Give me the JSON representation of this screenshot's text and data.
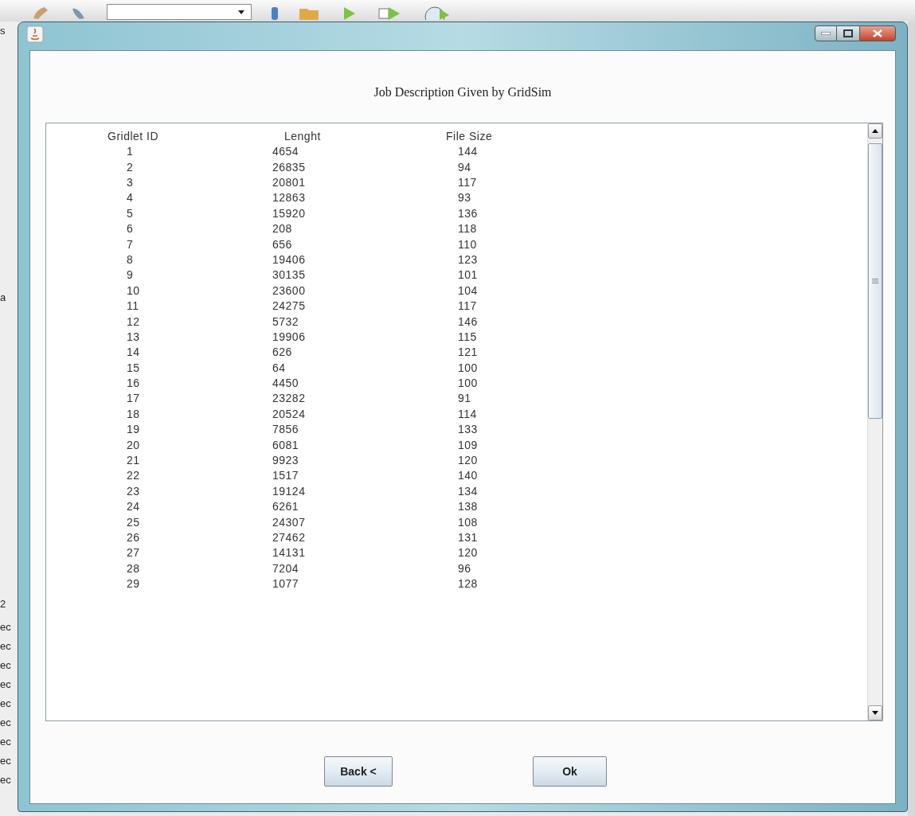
{
  "background": {
    "left_fragments": [
      "s",
      "a",
      "2",
      "ec",
      "ec",
      "ec",
      "ec",
      "ec",
      "ec",
      "ec",
      "ec",
      "ec"
    ]
  },
  "dialog": {
    "heading": "Job Description Given by GridSim",
    "table": {
      "columns": [
        "Gridlet ID",
        "Lenght",
        "File Size"
      ],
      "rows": [
        [
          "1",
          "4654",
          "144"
        ],
        [
          "2",
          "26835",
          "94"
        ],
        [
          "3",
          "20801",
          "117"
        ],
        [
          "4",
          "12863",
          "93"
        ],
        [
          "5",
          "15920",
          "136"
        ],
        [
          "6",
          "208",
          "118"
        ],
        [
          "7",
          "656",
          "110"
        ],
        [
          "8",
          "19406",
          "123"
        ],
        [
          "9",
          "30135",
          "101"
        ],
        [
          "10",
          "23600",
          "104"
        ],
        [
          "11",
          "24275",
          "117"
        ],
        [
          "12",
          "5732",
          "146"
        ],
        [
          "13",
          "19906",
          "115"
        ],
        [
          "14",
          "626",
          "121"
        ],
        [
          "15",
          "64",
          "100"
        ],
        [
          "16",
          "4450",
          "100"
        ],
        [
          "17",
          "23282",
          "91"
        ],
        [
          "18",
          "20524",
          "114"
        ],
        [
          "19",
          "7856",
          "133"
        ],
        [
          "20",
          "6081",
          "109"
        ],
        [
          "21",
          "9923",
          "120"
        ],
        [
          "22",
          "1517",
          "140"
        ],
        [
          "23",
          "19124",
          "134"
        ],
        [
          "24",
          "6261",
          "138"
        ],
        [
          "25",
          "24307",
          "108"
        ],
        [
          "26",
          "27462",
          "131"
        ],
        [
          "27",
          "14131",
          "120"
        ],
        [
          "28",
          "7204",
          "96"
        ],
        [
          "29",
          "1077",
          "128"
        ]
      ]
    },
    "buttons": [
      "Back <",
      "Ok"
    ]
  }
}
